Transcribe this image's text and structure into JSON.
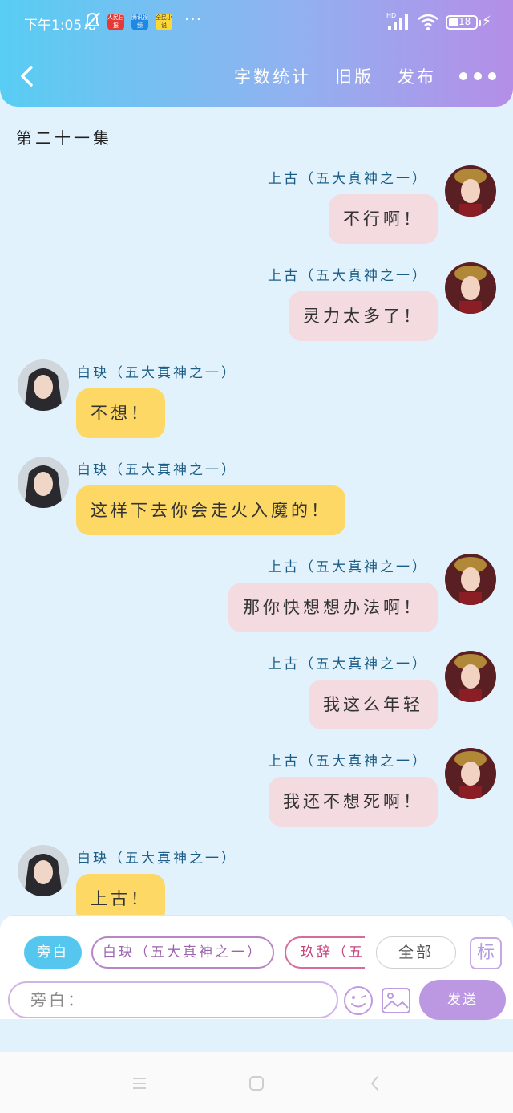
{
  "status_bar": {
    "time": "下午1:05",
    "apps": [
      "人民日报",
      "腾讯视频",
      "全民小说"
    ],
    "network": "HD",
    "battery": "18"
  },
  "header": {
    "back_icon": "chevron-left-icon",
    "word_count_label": "字数统计",
    "old_version_label": "旧版",
    "publish_label": "发布",
    "more_icon": "more-dots-icon"
  },
  "episode_title": "第二十一集",
  "messages": [
    {
      "side": "right",
      "speaker": "上古（五大真神之一）",
      "text": "不行啊！",
      "avatar": "shanggu"
    },
    {
      "side": "right",
      "speaker": "上古（五大真神之一）",
      "text": "灵力太多了！",
      "avatar": "shanggu"
    },
    {
      "side": "left",
      "speaker": "白玦（五大真神之一）",
      "text": "不想！",
      "avatar": "baijue"
    },
    {
      "side": "left",
      "speaker": "白玦（五大真神之一）",
      "text": "这样下去你会走火入魔的！",
      "avatar": "baijue"
    },
    {
      "side": "right",
      "speaker": "上古（五大真神之一）",
      "text": "那你快想想办法啊！",
      "avatar": "shanggu"
    },
    {
      "side": "right",
      "speaker": "上古（五大真神之一）",
      "text": "我这么年轻",
      "avatar": "shanggu"
    },
    {
      "side": "right",
      "speaker": "上古（五大真神之一）",
      "text": "我还不想死啊！",
      "avatar": "shanggu"
    },
    {
      "side": "left",
      "speaker": "白玦（五大真神之一）",
      "text": "上古！",
      "avatar": "baijue"
    }
  ],
  "role_chips": {
    "narrator": "旁白",
    "char1": "白玦（五大真神之一）",
    "char2": "玖辞（五大",
    "all": "全部",
    "mark": "标"
  },
  "composer": {
    "placeholder": "旁白：",
    "value": "",
    "emoji_icon": "emoji-icon",
    "image_icon": "image-icon",
    "send_label": "发送"
  },
  "system_nav": {
    "menu_icon": "menu-icon",
    "home_icon": "home-icon",
    "back_icon": "back-icon"
  },
  "colors": {
    "header_gradient_start": "#58cdf3",
    "header_gradient_end": "#b58ee8",
    "chat_background": "#e1f2fc",
    "right_bubble": "#f3dbe0",
    "left_bubble": "#fdd865",
    "speaker_name": "#1b5d86",
    "send_button": "#bc98e3",
    "narrator_chip": "#55c6ee"
  }
}
